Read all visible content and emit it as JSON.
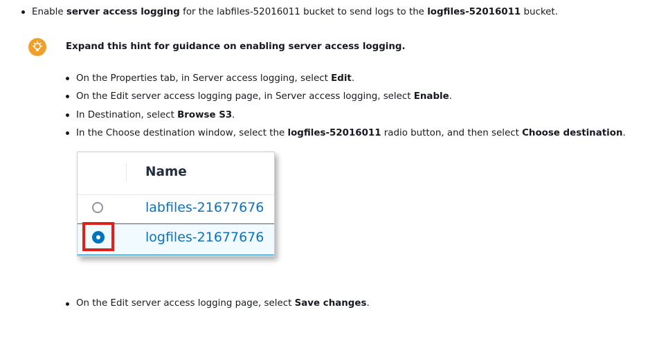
{
  "step": {
    "p1": "Enable ",
    "b1": "server access logging",
    "p2": " for the labfiles-52016011 bucket to send logs to the ",
    "b2": "logfiles-52016011",
    "p3": " bucket."
  },
  "hint": {
    "icon": "lightbulb-icon",
    "title": "Expand this hint for guidance on enabling server access logging."
  },
  "substeps": [
    {
      "p1": "On the Properties tab, in Server access logging, select ",
      "b1": "Edit",
      "p2": "."
    },
    {
      "p1": "On the Edit server access logging page, in Server access logging, select ",
      "b1": "Enable",
      "p2": "."
    },
    {
      "p1": "In Destination, select ",
      "b1": "Browse S3",
      "p2": "."
    },
    {
      "p1": "In the Choose destination window, select the ",
      "b1": "logfiles-52016011",
      "p2": " radio button, and then select ",
      "b2": "Choose destination",
      "p3": "."
    }
  ],
  "figure": {
    "header": "Name",
    "rows": [
      {
        "name": "labfiles-21677676",
        "selected": false
      },
      {
        "name": "logfiles-21677676",
        "selected": true
      }
    ],
    "highlight_color": "#e0201b"
  },
  "final_step": {
    "p1": "On the Edit server access logging page, select ",
    "b1": "Save changes",
    "p2": "."
  },
  "colors": {
    "hint_icon": "#f0a028",
    "link": "#0b73bb",
    "radio": "#0073bb"
  }
}
